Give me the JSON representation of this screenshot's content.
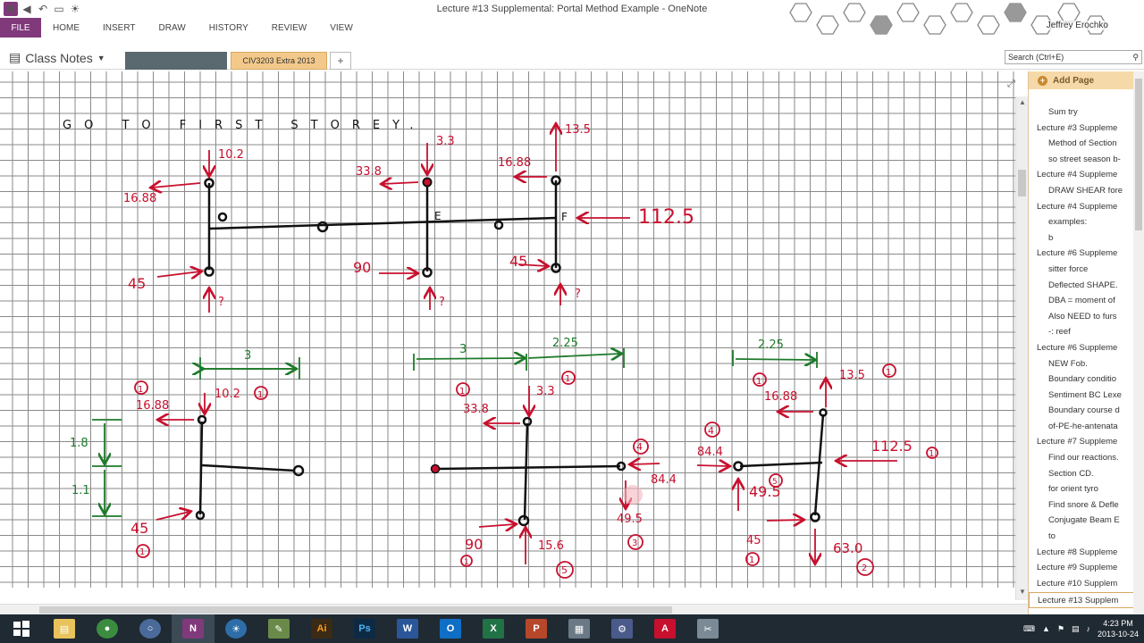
{
  "window": {
    "title": "Lecture #13 Supplemental: Portal Method Example - OneNote"
  },
  "ribbon": {
    "file": "FILE",
    "tabs": [
      "HOME",
      "INSERT",
      "DRAW",
      "HISTORY",
      "REVIEW",
      "VIEW"
    ]
  },
  "user": {
    "name": "Jeffrey Erochko"
  },
  "notebook": {
    "name": "Class Notes",
    "sections": [
      "CIV3203 Extra 2013"
    ],
    "add_tab": "+"
  },
  "search": {
    "placeholder": "Search (Ctrl+E)"
  },
  "page_pane": {
    "add_page": "Add Page",
    "pages": [
      {
        "label": "Sum try",
        "level": 2
      },
      {
        "label": "Lecture #3 Suppleme",
        "level": 1
      },
      {
        "label": "Method of Section",
        "level": 2
      },
      {
        "label": "so street season b-",
        "level": 2
      },
      {
        "label": "Lecture #4 Suppleme",
        "level": 1
      },
      {
        "label": "DRAW SHEAR fore",
        "level": 2
      },
      {
        "label": "Lecture #4 Suppleme",
        "level": 1
      },
      {
        "label": "examples:",
        "level": 2
      },
      {
        "label": "b",
        "level": 2
      },
      {
        "label": "Lecture #6 Suppleme",
        "level": 1
      },
      {
        "label": "sitter force",
        "level": 2
      },
      {
        "label": "Deflected SHAPE.",
        "level": 2
      },
      {
        "label": "DBA = moment of",
        "level": 2
      },
      {
        "label": "Also NEED to furs",
        "level": 2
      },
      {
        "label": "-: reef",
        "level": 2
      },
      {
        "label": "Lecture #6 Suppleme",
        "level": 1
      },
      {
        "label": "NEW Fob.",
        "level": 2
      },
      {
        "label": "Boundary conditio",
        "level": 2
      },
      {
        "label": "Sentiment BC Lexe",
        "level": 2
      },
      {
        "label": "Boundary course d",
        "level": 2
      },
      {
        "label": "of-PE-he-antenata",
        "level": 2
      },
      {
        "label": "Lecture #7 Suppleme",
        "level": 1
      },
      {
        "label": "Find our reactions.",
        "level": 2
      },
      {
        "label": "Section CD.",
        "level": 2
      },
      {
        "label": "for orient tyro",
        "level": 2
      },
      {
        "label": "Find snore & Defle",
        "level": 2
      },
      {
        "label": "Conjugate Beam E",
        "level": 2
      },
      {
        "label": "to",
        "level": 2
      },
      {
        "label": "Lecture #8 Suppleme",
        "level": 1
      },
      {
        "label": "Lecture #9 Suppleme",
        "level": 1
      },
      {
        "label": "Lecture #10 Supplem",
        "level": 1
      },
      {
        "label": "Lecture #13 Supplem",
        "level": 1,
        "selected": true
      }
    ]
  },
  "ink": {
    "heading": "GO TO FIRST STOREY.",
    "top": {
      "v1": "10.2",
      "h1": "16.88",
      "base1": "45",
      "q": "?",
      "v2": "3.3",
      "h2": "33.8",
      "base2": "90",
      "labelE": "E",
      "v3": "13.5",
      "h3": "16.88",
      "base3": "45",
      "F": "F",
      "load": "112.5"
    },
    "bl": {
      "dim": "3",
      "c1": "1",
      "h": "16.88",
      "v": "10.2",
      "c2": "1",
      "d1": "1.8",
      "d2": "1.1",
      "base": "45",
      "c3": "1"
    },
    "bm": {
      "dim1": "3",
      "dim2": "2.25",
      "c1": "1",
      "v": "3.3",
      "c2": "1",
      "h": "33.8",
      "c4": "4",
      "rh": "84.4",
      "rv": "49.5",
      "c3": "3",
      "base": "90",
      "c5": "1",
      "up": "15.6",
      "c6": "5"
    },
    "br": {
      "dim": "2.25",
      "c1": "1",
      "h": "16.88",
      "top": "13.5",
      "c2": "1",
      "c4": "4",
      "lh": "84.4",
      "up": "49.5",
      "c5": "5",
      "load": "112.5",
      "c6": "1",
      "base": "45",
      "c7": "1",
      "down": "63.0",
      "c8": "2"
    }
  },
  "taskbar": {
    "apps": [
      "Start",
      "File Explorer",
      "Chrome",
      "App",
      "OneNote",
      "App",
      "Notepad",
      "Illustrator",
      "Photoshop",
      "Word",
      "Outlook",
      "Excel",
      "PowerPoint",
      "Calculator",
      "Tool",
      "Acrobat",
      "Tool"
    ],
    "time": "4:23 PM",
    "date": "2013-10-24"
  },
  "colors": {
    "onenote": "#80397b",
    "ink_red": "#c8102e",
    "ink_green": "#1e7a2a",
    "section_active": "#f3c98b"
  }
}
